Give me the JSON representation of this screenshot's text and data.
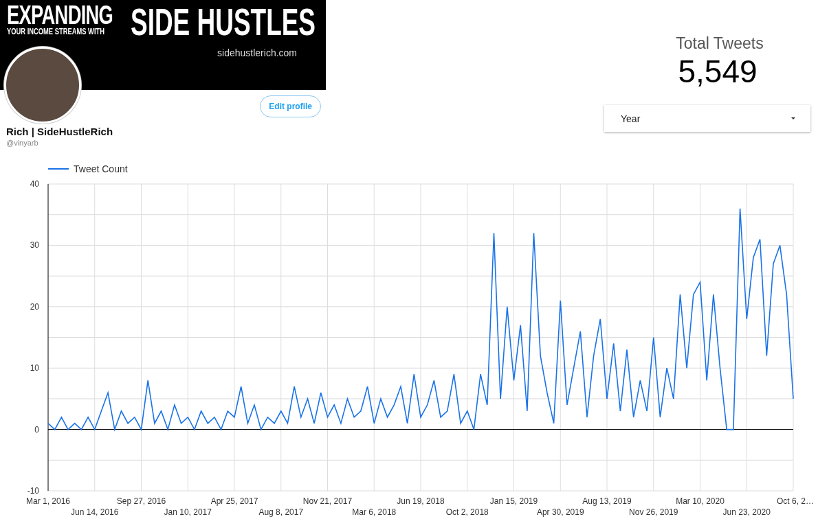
{
  "profile": {
    "banner": {
      "headline": "EXPANDING",
      "tagline": "YOUR INCOME STREAMS WITH",
      "headline_2": "SIDE HUSTLES",
      "website": "sidehustlerich.com"
    },
    "edit_button": "Edit profile",
    "name": "Rich | SideHustleRich",
    "handle": "@vinyarb"
  },
  "scorecard": {
    "label": "Total Tweets",
    "value": "5,549"
  },
  "dropdown": {
    "value": "Year"
  },
  "chart": {
    "chart_data": {
      "type": "line",
      "grid": true,
      "ylim": [
        -10,
        40
      ],
      "yticks": [
        -10,
        0,
        10,
        20,
        30,
        40
      ],
      "categories": [
        "Mar 1, 2016",
        null,
        null,
        null,
        null,
        null,
        null,
        "Jun 14, 2016",
        null,
        null,
        null,
        null,
        null,
        null,
        "Sep 27, 2016",
        null,
        null,
        null,
        null,
        null,
        null,
        "Jan 10, 2017",
        null,
        null,
        null,
        null,
        null,
        null,
        "Apr 25, 2017",
        null,
        null,
        null,
        null,
        null,
        null,
        "Aug 8, 2017",
        null,
        null,
        null,
        null,
        null,
        null,
        "Nov 21, 2017",
        null,
        null,
        null,
        null,
        null,
        null,
        "Mar 6, 2018",
        null,
        null,
        null,
        null,
        null,
        null,
        "Jun 19, 2018",
        null,
        null,
        null,
        null,
        null,
        null,
        "Oct 2, 2018",
        null,
        null,
        null,
        null,
        null,
        null,
        "Jan 15, 2019",
        null,
        null,
        null,
        null,
        null,
        null,
        "Apr 30, 2019",
        null,
        null,
        null,
        null,
        null,
        null,
        "Aug 13, 2019",
        null,
        null,
        null,
        null,
        null,
        null,
        "Nov 26, 2019",
        null,
        null,
        null,
        null,
        null,
        null,
        "Mar 10, 2020",
        null,
        null,
        null,
        null,
        null,
        null,
        "Jun 23, 2020",
        null,
        null,
        null,
        null,
        null,
        null,
        "Oct 6, 2…"
      ],
      "series": [
        {
          "name": "Tweet Count",
          "color": "#1a73e8",
          "values": [
            1,
            0,
            2,
            0,
            1,
            0,
            2,
            0,
            3,
            6,
            0,
            3,
            1,
            2,
            0,
            8,
            1,
            3,
            0,
            4,
            1,
            2,
            0,
            3,
            1,
            2,
            0,
            3,
            2,
            7,
            1,
            4,
            0,
            2,
            1,
            3,
            1,
            7,
            2,
            5,
            1,
            6,
            2,
            4,
            1,
            5,
            2,
            3,
            7,
            1,
            5,
            2,
            4,
            7,
            1,
            9,
            2,
            4,
            8,
            2,
            3,
            9,
            1,
            3,
            0,
            9,
            4,
            32,
            5,
            20,
            8,
            17,
            3,
            32,
            12,
            6,
            1,
            21,
            4,
            10,
            16,
            2,
            12,
            18,
            5,
            14,
            3,
            13,
            2,
            8,
            3,
            15,
            2,
            10,
            5,
            22,
            10,
            22,
            24,
            8,
            22,
            10,
            0,
            0,
            36,
            18,
            28,
            31,
            12,
            27,
            30,
            22,
            5
          ]
        }
      ]
    }
  }
}
